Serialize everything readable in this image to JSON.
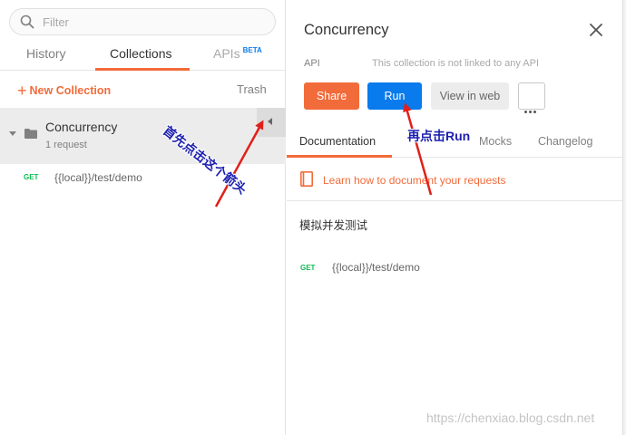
{
  "sidebar": {
    "filter_placeholder": "Filter",
    "tabs": [
      {
        "label": "History"
      },
      {
        "label": "Collections"
      },
      {
        "label": "APIs",
        "badge": "BETA"
      }
    ],
    "new_collection": "New Collection",
    "new_collection_plus": "+",
    "trash": "Trash",
    "collection": {
      "name": "Concurrency",
      "count": "1 request"
    },
    "request": {
      "method": "GET",
      "url": "{{local}}/test/demo"
    }
  },
  "panel": {
    "title": "Concurrency",
    "api_label": "API",
    "api_note": "This collection is not linked to any API",
    "buttons": {
      "share": "Share",
      "run": "Run",
      "view_web": "View in web"
    },
    "tabs": [
      {
        "label": "Documentation"
      },
      {
        "label": "Mocks"
      },
      {
        "label": "Changelog"
      }
    ],
    "learn": "Learn how to document your requests",
    "description": "模拟并发测试",
    "request": {
      "method": "GET",
      "url": "{{local}}/test/demo"
    }
  },
  "annotations": {
    "first": "首先点击这个箭头",
    "second": "再点击Run"
  },
  "watermark": "https://chenxiao.blog.csdn.net",
  "colors": {
    "accent": "#f26b3a",
    "run": "#097bed",
    "get": "#0cbb52",
    "annotation": "#1d1fb0",
    "arrow": "#e0201a"
  },
  "icons": [
    "search-icon",
    "folder-icon",
    "caret-down-icon",
    "caret-left-icon",
    "close-icon",
    "more-icon",
    "book-icon"
  ]
}
